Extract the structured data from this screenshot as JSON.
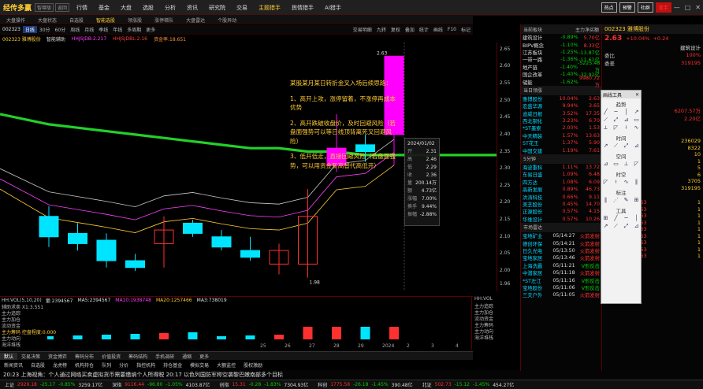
{
  "menubar": {
    "brand": "经传多赢",
    "tag1": "智尊版",
    "tag2": "返回",
    "items": [
      "行情",
      "基金",
      "大盘",
      "选股",
      "分析",
      "资讯",
      "研究院",
      "交易",
      "主题猎手",
      "舆情猎手",
      "AI猎手"
    ],
    "highlight_index": 8,
    "buttons": [
      "热点",
      "预警",
      "社群",
      "看手"
    ],
    "win": [
      "—",
      "□",
      "✕"
    ]
  },
  "tabbar": {
    "items": [
      "大盘操作",
      "大盘状态",
      "自选股",
      "智能选股",
      "领涨股",
      "涨停梯队",
      "大盘雷达",
      "个股异动"
    ],
    "active": 3
  },
  "toolbar": {
    "code": "002323",
    "periods": [
      "日线",
      "30分",
      "60分",
      "周线",
      "月线",
      "季线",
      "年线",
      "多周期",
      "更多"
    ],
    "selected": 0,
    "right": [
      "交易明细",
      "九转",
      "复权",
      "叠加",
      "统计",
      "画线",
      "F10",
      "标记"
    ]
  },
  "infobar": {
    "stock": "002323 雅博股份",
    "indicators": [
      "智能辅助",
      "HHJSJDB:2.217",
      "HHJSJDBL:2.16",
      "资金率:18.651"
    ]
  },
  "yaxis": [
    "2.65",
    "2.60",
    "2.55",
    "2.50",
    "2.45",
    "2.40",
    "2.35",
    "2.30",
    "2.25",
    "2.20",
    "2.15",
    "2.10",
    "2.05",
    "2.00",
    "1.96"
  ],
  "price_range": [
    1.94,
    2.67
  ],
  "price_marks": {
    "high": "2.63",
    "low": "1.98"
  },
  "annotation": {
    "title": "某股某月某日转折金叉入场后续思路：",
    "p1": "1、高开上攻，涨停留着，不涨停再成本优势",
    "p2": "2、高开跌破收盘价，及时回避风险（若盘面强势可以等日线顶背离死叉回避风险）",
    "p3": "3、低开低走，直接回避风险（若盘面强势，可以用资金新高替代高低开）"
  },
  "tooltip": {
    "date": "2024/01/02",
    "rows": [
      [
        "开",
        "2.31"
      ],
      [
        "高",
        "2.46"
      ],
      [
        "低",
        "2.29"
      ],
      [
        "收",
        "2.36"
      ],
      [
        "量",
        "200.14万"
      ],
      [
        "额",
        "4.73亿"
      ],
      [
        "涨幅",
        "7.00%"
      ],
      [
        "换手",
        "9.44%"
      ],
      [
        "振幅",
        "-2.88%"
      ]
    ]
  },
  "chart_data": {
    "type": "candlestick",
    "candles": [
      {
        "o": 2.16,
        "c": 2.1,
        "h": 2.19,
        "l": 2.07
      },
      {
        "o": 2.11,
        "c": 2.08,
        "h": 2.14,
        "l": 2.06
      },
      {
        "o": 2.09,
        "c": 2.03,
        "h": 2.11,
        "l": 2.01
      },
      {
        "o": 2.03,
        "c": 2.01,
        "h": 2.05,
        "l": 2.0
      },
      {
        "o": 2.08,
        "c": 2.12,
        "h": 2.16,
        "l": 2.01
      },
      {
        "o": 2.14,
        "c": 2.11,
        "h": 2.15,
        "l": 2.1
      },
      {
        "o": 2.1,
        "c": 2.07,
        "h": 2.12,
        "l": 2.06
      },
      {
        "o": 2.06,
        "c": 2.04,
        "h": 2.1,
        "l": 2.03
      },
      {
        "o": 2.02,
        "c": 2.06,
        "h": 2.08,
        "l": 1.99
      },
      {
        "o": 2.02,
        "c": 2.16,
        "h": 2.24,
        "l": 1.98
      },
      {
        "o": 2.31,
        "c": 2.36,
        "h": 2.46,
        "l": 2.29
      },
      {
        "o": 2.37,
        "c": 2.35,
        "h": 2.4,
        "l": 2.32
      },
      {
        "o": 2.4,
        "c": 2.63,
        "h": 2.63,
        "l": 2.31
      }
    ],
    "ma_long": [
      2.43,
      2.42,
      2.41,
      2.4,
      2.39,
      2.38,
      2.37,
      2.36,
      2.36,
      2.35,
      2.35,
      2.34,
      2.34
    ],
    "x_ticks": [
      "25",
      "26",
      "27",
      "28",
      "29",
      "2024",
      "2",
      "3",
      "4"
    ]
  },
  "lower": {
    "vol_label": "HH:VOL(5,10,20)",
    "vol_vals": [
      "量:2394567",
      "MA5:2394567",
      "MA10:1938748",
      "MA20:1257466",
      "MA3:738019"
    ],
    "rows": [
      "辅助求卖 X1:3.551",
      "主力追踪",
      "主力加仓",
      "流动资金",
      "主力筹码 控盘程度:0.000",
      "主力动向",
      "海洋堆栈"
    ],
    "right_rows": [
      "HH:VOL",
      "主力追踪",
      "主力加仓",
      "流动资金",
      "主力筹码",
      "主力动向",
      "海洋堆栈"
    ]
  },
  "bottabs": {
    "items": [
      "默认",
      "交易决策",
      "资金博弈",
      "筹码分布",
      "价值投资",
      "筹码结构",
      "手机调研",
      "通缩",
      "更多"
    ],
    "active": 0
  },
  "news": {
    "items": [
      "新闻资讯",
      "自选股",
      "龙虎榜",
      "机构持仓",
      "队列",
      "分价",
      "指控机构",
      "持仓基金",
      "模拟交易",
      "大额监控",
      "股权激励"
    ],
    "ticker": "20:23 上海视角：个人通过网络买卖虚拟货币需要缴纳个人所得税 20:17 以色列国防军称空袭黎巴嫩南部多个目标"
  },
  "hot_panel": {
    "title": "当前板块",
    "col_right": "主力净买额",
    "groups1": [
      [
        "建筑设计",
        "-0.89%",
        "5.70亿"
      ],
      [
        "BIPV概念",
        "-1.10%",
        "8.33亿"
      ],
      [
        "江苏板块",
        "-1.25%",
        "-13.87亿"
      ],
      [
        "一带一路",
        "-1.36%",
        "-11.61亿"
      ],
      [
        "地产链",
        "-1.40%",
        "-5225.48万"
      ],
      [
        "国企改革",
        "-1.40%",
        "-32.92亿"
      ],
      [
        "储能",
        "-1.62%",
        "9980.72万"
      ]
    ],
    "header2": "当日领涨",
    "stocks": [
      [
        "雅博股份",
        "10.04%",
        "2.63"
      ],
      [
        "宏盛华源",
        "9.94%",
        "3.65"
      ],
      [
        "迪威日报",
        "3.52%",
        "17.35"
      ],
      [
        "西北钢化",
        "3.23%",
        "6.70"
      ],
      [
        "*ST墨索",
        "2.00%",
        "1.53"
      ],
      [
        "中天精装",
        "1.57%",
        "13.63"
      ],
      [
        "ST花王",
        "1.37%",
        "5.90"
      ],
      [
        "中国交建",
        "1.19%",
        "7.61"
      ]
    ],
    "header3": "5分钟",
    "stocks2": [
      [
        "海波重科",
        "1.11%",
        "13.72"
      ],
      [
        "东易日盛",
        "1.09%",
        "6.48"
      ],
      [
        "四方达",
        "1.08%",
        "6.09"
      ],
      [
        "高新发展",
        "0.89%",
        "46.73"
      ],
      [
        "洪涛科技",
        "0.66%",
        "9.11"
      ],
      [
        "美芝股份",
        "0.45%",
        "14.70"
      ],
      [
        "正源股份",
        "0.57%",
        "4.15"
      ],
      [
        "华维设计",
        "0.57%",
        "10.26"
      ]
    ],
    "header4": "市场雷达",
    "radar": [
      [
        "宝地矿业",
        "05/14:27",
        "火箭发射"
      ],
      [
        "德创环保",
        "05/14:21",
        "火箭发射"
      ],
      [
        "日久光电",
        "05/13:50",
        "火箭发射"
      ],
      [
        "宝地家居",
        "05/13:46",
        "火箭发射"
      ],
      [
        "上海洗霸",
        "05/11:21",
        "V形反击"
      ],
      [
        "中潜家居",
        "05/11:18",
        "火箭发射"
      ],
      [
        "*ST左江",
        "05/11:16",
        "V形反击"
      ],
      [
        "宝地股份",
        "05/11:06",
        "V形反击"
      ],
      [
        "三夫户外",
        "05/11:05",
        "火箭发射"
      ]
    ]
  },
  "quote_panel": {
    "code_name": "002323 雅博股份",
    "price": "2.63",
    "change": "+10.04%",
    "change_abs": "+0.24",
    "sector": "建筑设计",
    "lines": [
      [
        "委比",
        "100%"
      ],
      [
        "委差",
        "319195"
      ]
    ],
    "cents": [
      [
        "6207.57万"
      ],
      [
        "2.20亿"
      ]
    ],
    "vol_rows": [
      "236029",
      "8322",
      "10",
      "1",
      "5",
      "6",
      "3705",
      "319195"
    ],
    "trades": [
      [
        "14:56:48",
        "2.63",
        "1"
      ],
      [
        "14:56:51",
        "2.63",
        "1"
      ],
      [
        "14:56:54",
        "2.63",
        "1"
      ],
      [
        "14:56:57",
        "2.63",
        "1"
      ],
      [
        "14:57:00",
        "2.63",
        "1"
      ],
      [
        "14:57:03",
        "2.63",
        "1"
      ],
      [
        "14:57:06",
        "2.63",
        "1"
      ],
      [
        "14:57:09",
        "2.63",
        "1"
      ],
      [
        "14:57:12",
        "2.63",
        "1"
      ]
    ]
  },
  "drawtool": {
    "title": "画线工具",
    "close": "✕",
    "sections": [
      "趋势",
      "时间",
      "空间",
      "时空",
      "标注",
      "工具"
    ],
    "glyphs": [
      "╱",
      "─",
      "│",
      "↗",
      "⟋",
      "⤢",
      "⊿",
      "▭",
      "⟂",
      "◸",
      "⟊",
      "∿",
      "∥",
      "⋰",
      "✎",
      "⊞"
    ]
  },
  "idxbar": {
    "items": [
      [
        "上证",
        "2929.18",
        "-25.17",
        "-0.85%",
        "3259.17亿"
      ],
      [
        "深指",
        "9116.44",
        "-96.80",
        "-1.05%",
        "4103.87亿"
      ],
      [
        "创指",
        "15.31",
        "-0.28",
        "-1.83%",
        "7304.93亿"
      ],
      [
        "科创",
        "1775.58",
        "-26.18",
        "-1.45%",
        "390.48亿"
      ],
      [
        "北证",
        "502.73",
        "-15.12",
        "-1.45%",
        "454.27亿"
      ]
    ]
  },
  "colors": {
    "up": "#ff3030",
    "down": "#00e5ff",
    "ma_long": "#22d02a",
    "highlight": "#ff00ff",
    "accent": "#ffcc33"
  }
}
